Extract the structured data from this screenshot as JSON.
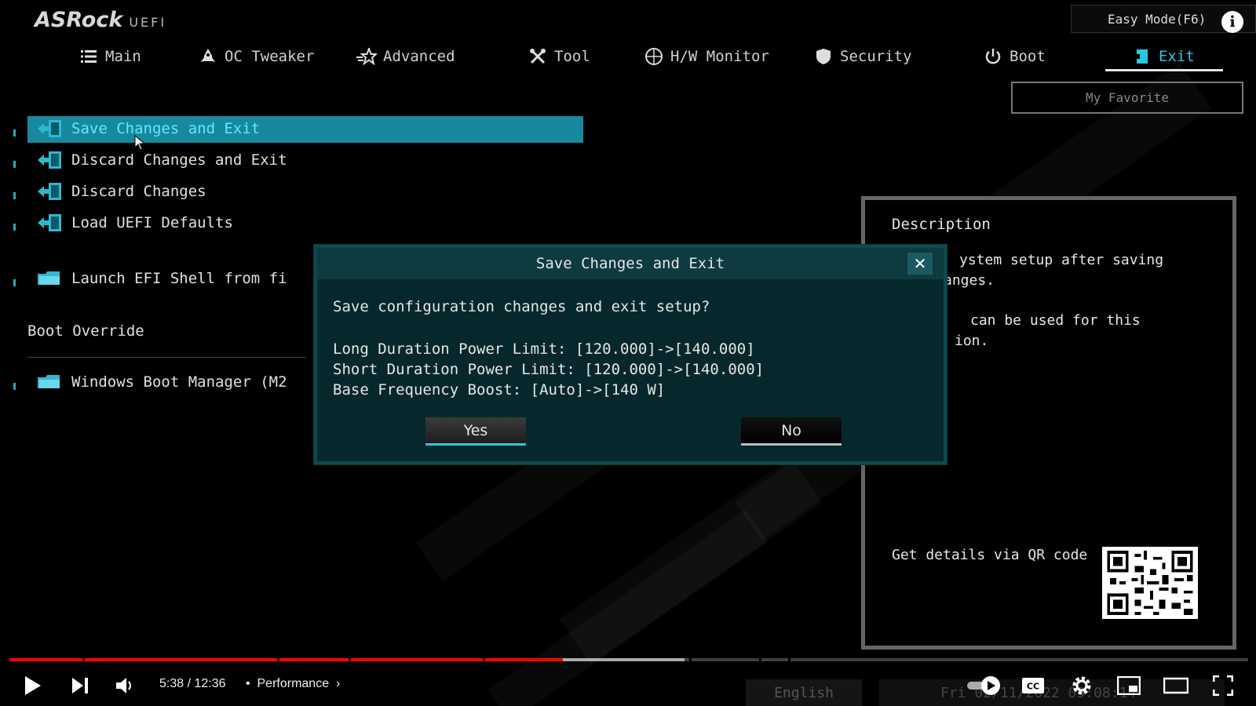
{
  "header": {
    "logo_main": "ASRock",
    "logo_sub": "UEFI",
    "easy_mode": "Easy Mode(F6)",
    "info": "i"
  },
  "nav": {
    "tabs": [
      {
        "label": "Main",
        "icon": "list-icon"
      },
      {
        "label": "OC Tweaker",
        "icon": "rocket-icon"
      },
      {
        "label": "Advanced",
        "icon": "star-icon"
      },
      {
        "label": "Tool",
        "icon": "tools-icon"
      },
      {
        "label": "H/W Monitor",
        "icon": "monitor-icon"
      },
      {
        "label": "Security",
        "icon": "shield-icon"
      },
      {
        "label": "Boot",
        "icon": "power-icon"
      },
      {
        "label": "Exit",
        "icon": "exit-icon"
      }
    ],
    "active": "Exit",
    "my_favorite": "My Favorite"
  },
  "menu": {
    "items": [
      {
        "label": "Save Changes and Exit",
        "icon": "exit-door-icon",
        "selected": true
      },
      {
        "label": "Discard Changes and Exit",
        "icon": "exit-door-icon"
      },
      {
        "label": "Discard Changes",
        "icon": "exit-door-icon"
      },
      {
        "label": "Load UEFI Defaults",
        "icon": "exit-door-icon"
      },
      {
        "label": "Launch EFI Shell from fi",
        "icon": "folder-icon"
      }
    ],
    "boot_override_label": "Boot Override",
    "boot_items": [
      {
        "label": "Windows Boot Manager (M2",
        "icon": "folder-icon"
      }
    ]
  },
  "description": {
    "title": "Description",
    "line1": "ystem setup after saving",
    "line2": "anges.",
    "line3": "can be used for this",
    "line4": "ion.",
    "qr_label": "Get details via QR code"
  },
  "dialog": {
    "title": "Save Changes and Exit",
    "question": "Save configuration changes and exit setup?",
    "changes": [
      "Long Duration Power Limit: [120.000]->[140.000]",
      "Short Duration Power Limit: [120.000]->[140.000]",
      "Base Frequency Boost: [Auto]->[140 W]"
    ],
    "yes": "Yes",
    "no": "No"
  },
  "player": {
    "time": "5:38 / 12:36",
    "separator": "•",
    "chapter": "Performance",
    "progress": 0.447,
    "buffered": 0.545,
    "controls": [
      "play-icon",
      "next-icon",
      "volume-icon",
      "autoplay-icon",
      "cc-icon",
      "settings-icon",
      "miniplayer-icon",
      "theater-icon",
      "fullscreen-icon"
    ]
  },
  "footer_faded": {
    "language": "English",
    "date": "Fri 02/11/2022 09:08:14"
  },
  "colors": {
    "accent": "#29c6e0",
    "highlight": "#17889e",
    "dialog_bg": "#06282c",
    "progress_red": "#ff0000"
  }
}
